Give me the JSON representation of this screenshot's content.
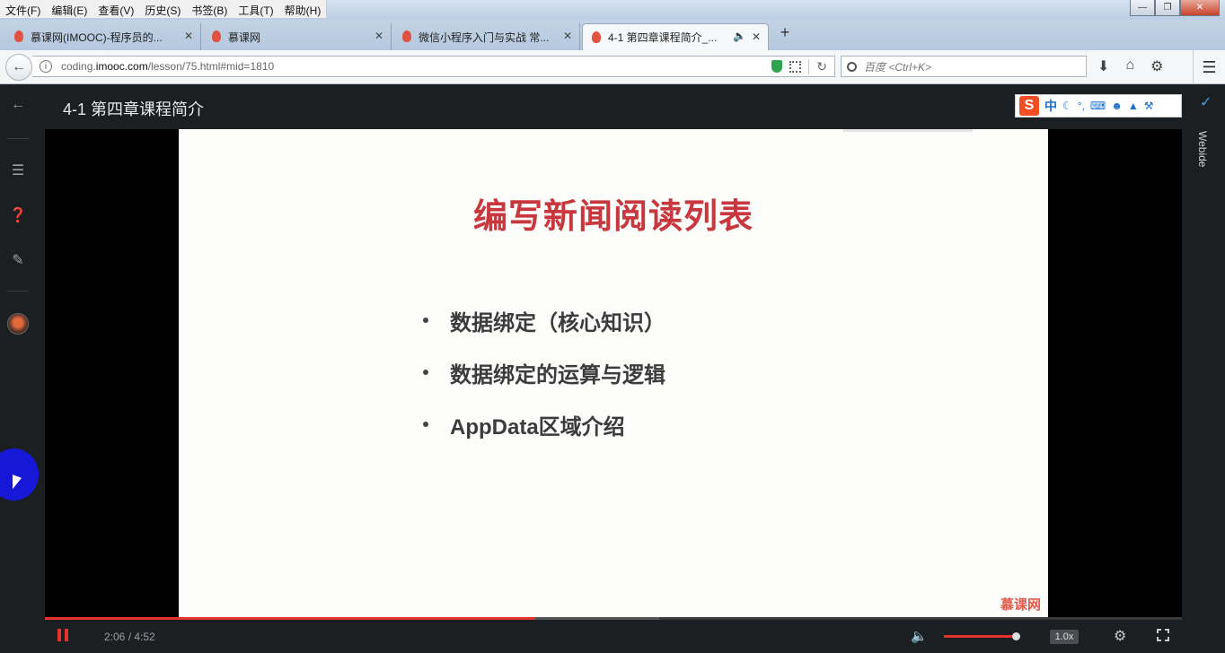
{
  "menu": [
    "文件(F)",
    "编辑(E)",
    "查看(V)",
    "历史(S)",
    "书签(B)",
    "工具(T)",
    "帮助(H)"
  ],
  "tabs": [
    {
      "label": "慕课网(IMOOC)-程序员的...",
      "active": false
    },
    {
      "label": "慕课网",
      "active": false
    },
    {
      "label": "微信小程序入门与实战 常...",
      "active": false
    },
    {
      "label": "4-1 第四章课程简介_...",
      "active": true
    }
  ],
  "address": {
    "prefix": "coding.",
    "domain": "imooc.com",
    "path": "/lesson/75.html#mid=1810"
  },
  "search": {
    "placeholder": "百度 <Ctrl+K>"
  },
  "page": {
    "lesson_title": "4-1 第四章课程简介",
    "webide_label": "Webide"
  },
  "ime": {
    "logo": "S",
    "mode": "中"
  },
  "slide": {
    "title": "编写新闻阅读列表",
    "bullets": [
      "数据绑定（核心知识）",
      "数据绑定的运算与逻辑",
      "AppData区域介绍"
    ],
    "watermark": "慕课网"
  },
  "player": {
    "current_time": "2:06",
    "duration": "4:52",
    "time_display": "2:06 / 4:52",
    "progress_fraction": 0.431,
    "buffered_fraction": 0.54,
    "volume_fraction": 1.0,
    "speed": "1.0x"
  },
  "colors": {
    "accent": "#e4332b",
    "slide_title": "#c8373d"
  }
}
